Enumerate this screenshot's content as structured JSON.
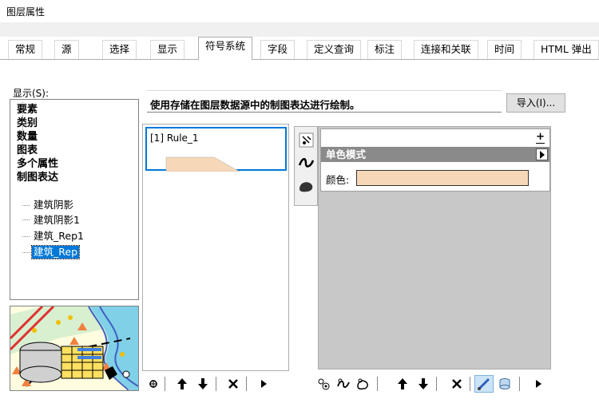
{
  "window": {
    "title": "图层属性"
  },
  "tabs": [
    {
      "label": "常规"
    },
    {
      "label": "源"
    },
    {
      "label": "选择"
    },
    {
      "label": "显示"
    },
    {
      "label": "符号系统",
      "active": true
    },
    {
      "label": "字段"
    },
    {
      "label": "定义查询"
    },
    {
      "label": "标注"
    },
    {
      "label": "连接和关联"
    },
    {
      "label": "时间"
    },
    {
      "label": "HTML 弹出"
    }
  ],
  "show": {
    "label": "显示(S):",
    "categories": [
      "要素",
      "类别",
      "数量",
      "图表",
      "多个属性",
      "制图表达"
    ],
    "representations": [
      {
        "label": "建筑阴影",
        "selected": false
      },
      {
        "label": "建筑阴影1",
        "selected": false
      },
      {
        "label": "建筑_Rep1",
        "selected": false
      },
      {
        "label": "建筑_Rep",
        "selected": true
      }
    ]
  },
  "description": "使用存储在图层数据源中的制图表达进行绘制。",
  "import_button": "导入(I)...",
  "rules": [
    {
      "name": "[1] Rule_1",
      "fill_color": "#f6d8b8"
    }
  ],
  "symbol": {
    "add_label": "+",
    "mode_title": "单色模式",
    "color_label": "颜色:",
    "color_value": "#f6d8b8"
  },
  "rules_toolbar_icons": [
    "add-rule-icon",
    "move-up-icon",
    "move-down-icon",
    "delete-icon",
    "more-icon"
  ],
  "symbol_toolbar_icons": [
    "add-marker-layer-icon",
    "add-stroke-layer-icon",
    "add-fill-layer-icon",
    "move-up-icon",
    "move-down-icon",
    "delete-icon",
    "brush-icon",
    "cylinder-icon",
    "more-icon"
  ],
  "colors": {
    "accent": "#0078d7",
    "header_gray": "#8a8a8a",
    "panel_gray": "#c8c8c8"
  }
}
